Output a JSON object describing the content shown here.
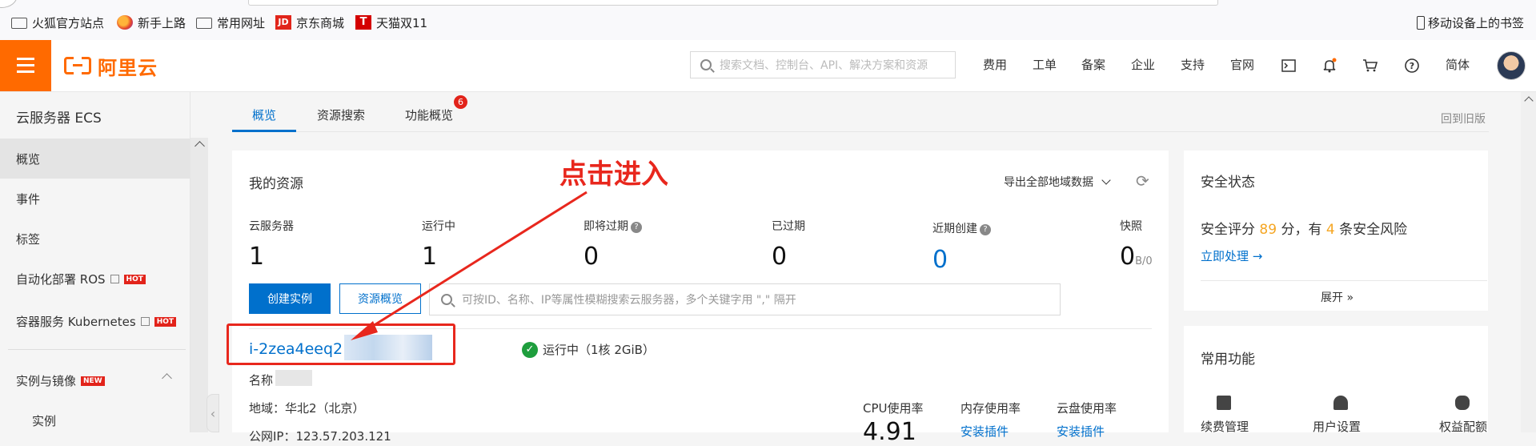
{
  "bookmarks": [
    {
      "label": "火狐官方站点",
      "icon": "folder-icon"
    },
    {
      "label": "新手上路",
      "icon": "firefox-icon"
    },
    {
      "label": "常用网址",
      "icon": "folder-icon"
    },
    {
      "label": "京东商城",
      "icon": "jd-icon"
    },
    {
      "label": "天猫双11",
      "icon": "tmall-icon"
    }
  ],
  "bookmarks_right": "移动设备上的书签",
  "header": {
    "logo": "阿里云",
    "search_placeholder": "搜索文档、控制台、API、解决方案和资源",
    "nav": [
      "费用",
      "工单",
      "备案",
      "企业",
      "支持",
      "官网"
    ],
    "lang": "简体"
  },
  "sidebar": {
    "title": "云服务器 ECS",
    "items": [
      "概览",
      "事件",
      "标签",
      "自动化部署 ROS",
      "容器服务 Kubernetes"
    ],
    "hot": "HOT",
    "new": "NEW",
    "group": "实例与镜像",
    "sub": "实例"
  },
  "tabs": {
    "items": [
      "概览",
      "资源搜索",
      "功能概览"
    ],
    "badge": "6",
    "old_version": "回到旧版"
  },
  "resources": {
    "title": "我的资源",
    "export": "导出全部地域数据",
    "stats": [
      {
        "label": "云服务器",
        "value": "1"
      },
      {
        "label": "运行中",
        "value": "1"
      },
      {
        "label": "即将过期",
        "value": "0"
      },
      {
        "label": "已过期",
        "value": "0"
      },
      {
        "label": "近期创建",
        "value": "0"
      },
      {
        "label": "快照",
        "value": "0",
        "suffix": "B/0"
      }
    ],
    "create_btn": "创建实例",
    "overview_btn": "资源概览",
    "search_placeholder": "可按ID、名称、IP等属性模糊搜索云服务器，多个关键字用 \",\" 隔开"
  },
  "instance": {
    "id": "i-2zea4eeq2",
    "status": "运行中",
    "spec": "（1核 2GiB）",
    "name_label": "名称",
    "region": "地域：华北2（北京）",
    "ip_partial": "公网IP：123.57.203.121",
    "cpu_label": "CPU使用率",
    "cpu_value": "4.91",
    "mem_label": "内存使用率",
    "disk_label": "云盘使用率",
    "install_plugin": "安装插件"
  },
  "annotation": "点击进入",
  "security": {
    "title": "安全状态",
    "score_prefix": "安全评分 ",
    "score": "89",
    "score_mid": " 分，有 ",
    "risks": "4",
    "score_suffix": " 条安全风险",
    "action": "立即处理 →",
    "expand": "展开 »"
  },
  "common": {
    "title": "常用功能",
    "items": [
      "续费管理",
      "用户设置",
      "权益配额"
    ]
  },
  "colors": {
    "brand": "#ff6a00",
    "primary": "#0070cc",
    "alert": "#e8271d"
  }
}
